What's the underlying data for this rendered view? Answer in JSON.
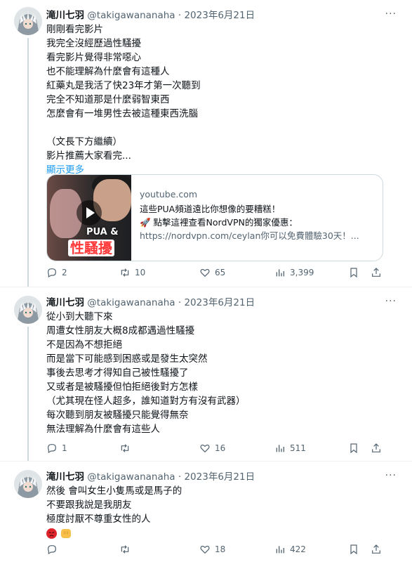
{
  "tweets": [
    {
      "author": "滝川七羽",
      "handle": "@takigawananaha",
      "date": "2023年6月21日",
      "more_label": "···",
      "lines": [
        "剛剛看完影片",
        "我完全沒經歷過性騷擾",
        "看完影片覺得非常噁心",
        "也不能理解為什麼會有這種人",
        "紅藥丸是我活了快23年才第一次聽到",
        "完全不知道那是什麼弱智東西",
        "怎麼會有一堆男性去被這種東西洗腦",
        "",
        "（文長下方繼續）",
        "影片推薦大家看完..."
      ],
      "show_more": "顯示更多",
      "card": {
        "domain": "youtube.com",
        "title": "這些PUA頻道遠比你想像的要糟糕！",
        "line2": "🚀 點擊這裡查看NordVPN的獨家優惠：",
        "line3": "https://nordvpn.com/ceylan你可以免費體驗30天！...",
        "thumb_text_small": "PUA &",
        "thumb_text_big": "性騷擾"
      },
      "stats": {
        "replies": "2",
        "retweets": "10",
        "likes": "65",
        "views": "3,399"
      }
    },
    {
      "author": "滝川七羽",
      "handle": "@takigawananaha",
      "date": "2023年6月21日",
      "more_label": "···",
      "lines": [
        "從小到大聽下來",
        "周遭女性朋友大概8成都遇過性騷擾",
        "不是因為不想拒絕",
        "而是當下可能感到困惑或是發生太突然",
        "事後去思考才得知自己被性騷擾了",
        "又或者是被騷擾但怕拒絕後對方怎樣",
        "（尤其現在怪人超多，誰知道對方有沒有武器）",
        "每次聽到朋友被騷擾只能覺得無奈",
        "無法理解為什麼會有這些人"
      ],
      "stats": {
        "replies": "1",
        "retweets": "",
        "likes": "16",
        "views": "511"
      }
    },
    {
      "author": "滝川七羽",
      "handle": "@takigawananaha",
      "date": "2023年6月21日",
      "more_label": "···",
      "lines": [
        "然後 會叫女生小隻馬或是馬子的",
        "不要跟我說是我朋友",
        "極度討厭不尊重女性的人"
      ],
      "emojis": [
        "angry-face-emoji",
        "fist-emoji"
      ],
      "stats": {
        "replies": "",
        "retweets": "",
        "likes": "18",
        "views": "422"
      }
    }
  ],
  "colors": {
    "text": "#0f1419",
    "secondary": "#536471",
    "link": "#1d9bf0",
    "border": "#cfd9de"
  }
}
